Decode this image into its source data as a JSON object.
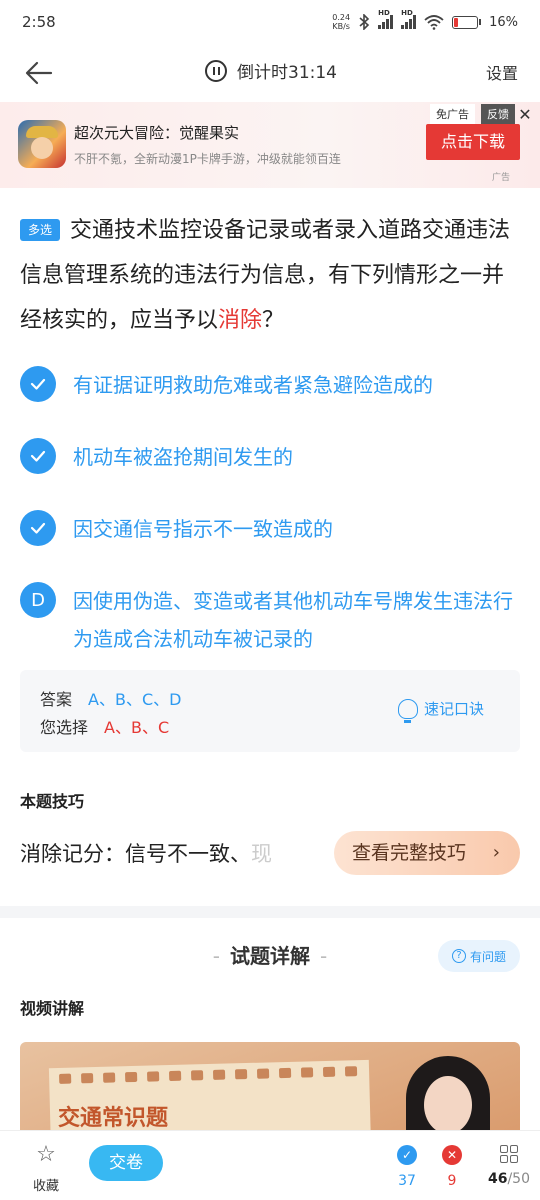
{
  "status_bar": {
    "time": "2:58",
    "net_speed_value": "0.24",
    "net_speed_unit": "KB/s",
    "signal_tags": [
      "HD",
      "HD"
    ],
    "battery_text": "16%",
    "battery_level": 0.16
  },
  "nav": {
    "timer_label": "倒计时31:14",
    "settings_label": "设置"
  },
  "ad": {
    "app_name": "超次元大冒险：觉醒果实",
    "description": "不肝不氪，全新动漫1P卡牌手游，冲级就能领百连",
    "tag_label": "免广告",
    "feedback_label": "反馈",
    "close_label": "✕",
    "download_label": "点击下载",
    "ad_label": "广告"
  },
  "question": {
    "type_label": "多选",
    "text_before": "交通技术监控设备记录或者录入道路交通违法信息管理系统的违法行为信息，有下列情形之一并经核实的，应当予以",
    "highlight": "消除",
    "text_after": "？"
  },
  "options": [
    {
      "mark": "check",
      "text": "有证据证明救助危难或者紧急避险造成的"
    },
    {
      "mark": "check",
      "text": "机动车被盗抢期间发生的"
    },
    {
      "mark": "check",
      "text": "因交通信号指示不一致造成的"
    },
    {
      "mark": "D",
      "text": "因使用伪造、变造或者其他机动车号牌发生违法行为造成合法机动车被记录的"
    }
  ],
  "answer": {
    "answer_label": "答案",
    "answer_value": "A、B、C、D",
    "selected_label": "您选择",
    "selected_value": "A、B、C",
    "memo_label": "速记口诀"
  },
  "tip": {
    "title": "本题技巧",
    "text": "消除记分：信号不一致、",
    "text_faded": "现",
    "button_label": "查看完整技巧"
  },
  "explanation": {
    "section_title": "试题详解",
    "report_label": "有问题",
    "video_title": "视频讲解",
    "video_label": "交通常识题"
  },
  "bottom_bar": {
    "favorite_label": "收藏",
    "submit_label": "交卷",
    "correct_count": "37",
    "wrong_count": "9",
    "progress_current": "46",
    "progress_total": "/50"
  },
  "colors": {
    "accent": "#2e9af0",
    "error": "#e53935",
    "submit": "#38b8f2"
  }
}
